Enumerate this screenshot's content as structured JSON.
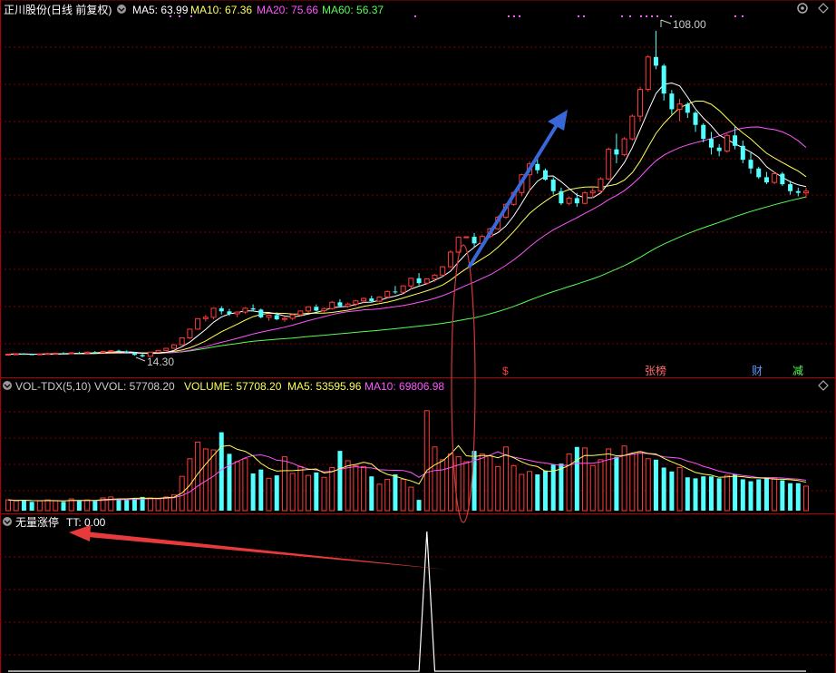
{
  "colors": {
    "background": "#000000",
    "up": "#ff3b3b",
    "down": "#54ffff",
    "ma5": "#ffffff",
    "ma10": "#ffff55",
    "ma20": "#ff55ff",
    "ma60": "#55ff55",
    "grid": "#800000",
    "arrow_blue": "#3a67d8",
    "arrow_red": "#e83a3a",
    "ellipse": "#d03a3a"
  },
  "main_panel": {
    "stock": "正川股份",
    "period": "(日线 前复权)",
    "ma5_label": "MA5: 63.99",
    "ma10_label": "MA10: 67.36",
    "ma20_label": "MA20: 75.66",
    "ma60_label": "MA60: 56.37",
    "high_label": "108.00",
    "low_label": "14.30",
    "markers": [
      "$",
      "张榜",
      "财",
      "减"
    ]
  },
  "volume_panel": {
    "name": "VOL-TDX(5,10)",
    "vvol": "VVOL: 57708.20",
    "volume": "VOLUME: 57708.20",
    "ma5": "MA5: 53595.96",
    "ma10": "MA10: 69806.98"
  },
  "signal_panel": {
    "name": "无量涨停",
    "tt": "TT: 0.00"
  },
  "chart_data": [
    {
      "type": "candlestick",
      "title": "正川股份(日线 前复权)",
      "series_labels": [
        "MA5",
        "MA10",
        "MA20",
        "MA60"
      ],
      "price_range": [
        14.3,
        108.0
      ],
      "grid": true,
      "candles_ohlc": [
        [
          15.1,
          15.4,
          14.9,
          15.2
        ],
        [
          15.2,
          15.5,
          15.0,
          15.3
        ],
        [
          15.3,
          15.5,
          15.1,
          15.2
        ],
        [
          15.2,
          15.4,
          15.0,
          15.1
        ],
        [
          15.1,
          15.4,
          14.9,
          15.3
        ],
        [
          15.3,
          15.6,
          15.1,
          15.4
        ],
        [
          15.4,
          15.7,
          15.2,
          15.5
        ],
        [
          15.5,
          15.8,
          15.3,
          15.4
        ],
        [
          15.4,
          15.8,
          15.2,
          15.6
        ],
        [
          15.6,
          15.9,
          15.3,
          15.5
        ],
        [
          15.5,
          16.0,
          15.3,
          15.8
        ],
        [
          15.8,
          16.1,
          15.5,
          15.7
        ],
        [
          15.7,
          16.2,
          15.6,
          16.0
        ],
        [
          16.0,
          16.4,
          15.8,
          16.2
        ],
        [
          16.2,
          16.5,
          15.8,
          16.0
        ],
        [
          16.0,
          16.3,
          15.5,
          15.6
        ],
        [
          15.6,
          15.8,
          14.8,
          15.0
        ],
        [
          15.0,
          15.3,
          14.3,
          14.6
        ],
        [
          14.6,
          15.9,
          14.5,
          15.8
        ],
        [
          15.8,
          16.4,
          15.6,
          16.3
        ],
        [
          16.3,
          17.0,
          16.1,
          16.9
        ],
        [
          16.9,
          18.0,
          16.7,
          17.9
        ],
        [
          17.9,
          20.0,
          17.8,
          19.9
        ],
        [
          19.9,
          22.5,
          19.6,
          22.4
        ],
        [
          22.4,
          25.5,
          22.2,
          25.4
        ],
        [
          25.4,
          26.5,
          24.6,
          25.8
        ],
        [
          25.8,
          28.5,
          25.2,
          28.4
        ],
        [
          28.4,
          29.0,
          26.6,
          27.5
        ],
        [
          27.5,
          28.2,
          26.2,
          26.8
        ],
        [
          26.8,
          27.5,
          25.8,
          27.3
        ],
        [
          27.3,
          28.6,
          26.8,
          28.4
        ],
        [
          28.4,
          29.5,
          27.6,
          28.0
        ],
        [
          28.0,
          28.3,
          25.5,
          25.8
        ],
        [
          25.8,
          26.6,
          24.8,
          26.4
        ],
        [
          26.4,
          27.2,
          25.0,
          25.2
        ],
        [
          25.2,
          26.2,
          24.5,
          25.5
        ],
        [
          25.5,
          26.8,
          25.0,
          26.5
        ],
        [
          26.5,
          27.8,
          26.0,
          27.6
        ],
        [
          27.6,
          29.0,
          27.0,
          28.8
        ],
        [
          28.8,
          29.5,
          27.5,
          27.7
        ],
        [
          27.7,
          28.6,
          27.2,
          28.3
        ],
        [
          28.3,
          30.5,
          28.0,
          30.1
        ],
        [
          30.1,
          31.0,
          28.6,
          29.0
        ],
        [
          29.0,
          30.0,
          28.5,
          29.6
        ],
        [
          29.6,
          30.8,
          29.0,
          30.5
        ],
        [
          30.5,
          31.5,
          29.8,
          31.2
        ],
        [
          31.2,
          32.0,
          30.0,
          30.4
        ],
        [
          30.4,
          31.8,
          30.1,
          31.6
        ],
        [
          31.6,
          33.5,
          31.2,
          33.2
        ],
        [
          33.2,
          34.8,
          32.5,
          33.0
        ],
        [
          33.0,
          35.0,
          32.8,
          34.8
        ],
        [
          34.8,
          37.2,
          33.8,
          37.0
        ],
        [
          37.0,
          38.5,
          35.0,
          35.6
        ],
        [
          35.6,
          37.0,
          35.2,
          36.8
        ],
        [
          36.8,
          38.2,
          36.0,
          37.9
        ],
        [
          37.9,
          40.5,
          37.5,
          40.3
        ],
        [
          40.3,
          45.0,
          40.0,
          44.5
        ],
        [
          44.5,
          49.0,
          44.2,
          48.8
        ],
        [
          48.8,
          49.0,
          48.5,
          48.9
        ],
        [
          48.9,
          50.0,
          46.0,
          47.0
        ],
        [
          47.0,
          49.5,
          46.5,
          49.0
        ],
        [
          49.0,
          51.5,
          48.5,
          51.2
        ],
        [
          51.2,
          55.0,
          50.8,
          54.5
        ],
        [
          54.5,
          58.5,
          54.0,
          58.2
        ],
        [
          58.2,
          62.0,
          57.8,
          61.6
        ],
        [
          61.6,
          67.0,
          60.5,
          66.7
        ],
        [
          66.7,
          70.5,
          62.0,
          69.8
        ],
        [
          69.8,
          72.5,
          67.0,
          68.0
        ],
        [
          68.0,
          68.5,
          65.0,
          65.3
        ],
        [
          65.3,
          66.0,
          61.0,
          62.0
        ],
        [
          62.0,
          63.0,
          58.0,
          58.5
        ],
        [
          58.5,
          60.5,
          58.0,
          60.0
        ],
        [
          60.0,
          61.5,
          57.5,
          58.5
        ],
        [
          58.5,
          62.0,
          58.2,
          61.5
        ],
        [
          61.5,
          63.5,
          60.0,
          62.0
        ],
        [
          62.0,
          66.0,
          61.5,
          65.5
        ],
        [
          65.5,
          74.5,
          65.2,
          74.0
        ],
        [
          74.0,
          78.5,
          70.0,
          72.5
        ],
        [
          72.5,
          77.5,
          72.0,
          77.0
        ],
        [
          77.0,
          84.0,
          76.5,
          83.5
        ],
        [
          83.5,
          92.0,
          82.0,
          91.2
        ],
        [
          91.2,
          101.0,
          90.5,
          100.5
        ],
        [
          100.5,
          108.0,
          97.0,
          98.0
        ],
        [
          98.0,
          98.5,
          88.0,
          90.0
        ],
        [
          90.0,
          91.0,
          84.0,
          85.5
        ],
        [
          85.5,
          88.5,
          82.0,
          87.0
        ],
        [
          87.0,
          87.5,
          83.0,
          84.5
        ],
        [
          84.5,
          85.0,
          79.0,
          81.0
        ],
        [
          81.0,
          81.5,
          76.0,
          77.0
        ],
        [
          77.0,
          79.0,
          72.5,
          74.5
        ],
        [
          74.5,
          75.5,
          72.0,
          73.5
        ],
        [
          73.5,
          78.5,
          73.0,
          78.0
        ],
        [
          78.0,
          80.5,
          74.0,
          75.0
        ],
        [
          75.0,
          76.5,
          70.0,
          71.0
        ],
        [
          71.0,
          73.0,
          67.0,
          68.5
        ],
        [
          68.5,
          69.0,
          65.5,
          66.0
        ],
        [
          66.0,
          67.5,
          64.0,
          64.5
        ],
        [
          64.5,
          67.5,
          64.0,
          67.0
        ],
        [
          67.0,
          67.5,
          63.5,
          64.0
        ],
        [
          64.0,
          65.0,
          61.0,
          62.0
        ],
        [
          62.0,
          63.0,
          60.5,
          61.5
        ],
        [
          61.5,
          63.0,
          60.0,
          62.0
        ]
      ]
    },
    {
      "type": "bar",
      "title": "VOL-TDX(5,10)",
      "series_labels": [
        "VOLUME",
        "MA5",
        "MA10"
      ],
      "volume_max_units": 10.0,
      "values": [
        1.1,
        1.0,
        1.1,
        0.9,
        1.0,
        1.1,
        1.0,
        0.9,
        1.2,
        1.0,
        1.1,
        1.0,
        1.3,
        1.4,
        1.2,
        1.1,
        1.3,
        1.4,
        1.3,
        1.2,
        1.4,
        1.6,
        3.5,
        5.3,
        7.0,
        6.3,
        6.2,
        8.0,
        5.8,
        5.0,
        5.3,
        3.8,
        4.2,
        3.3,
        3.6,
        5.5,
        3.8,
        4.5,
        3.6,
        3.9,
        3.4,
        4.4,
        6.1,
        5.1,
        4.6,
        4.5,
        3.5,
        2.7,
        3.2,
        3.7,
        3.2,
        2.4,
        1.1,
        10.2,
        6.5,
        5.2,
        5.8,
        5.5,
        5.0,
        6.1,
        5.8,
        5.6,
        4.5,
        6.5,
        4.6,
        3.7,
        4.0,
        3.7,
        4.1,
        4.7,
        4.8,
        5.8,
        6.5,
        6.4,
        4.6,
        5.2,
        6.3,
        5.5,
        6.6,
        5.8,
        6.0,
        5.3,
        5.2,
        4.4,
        4.0,
        4.4,
        3.4,
        3.3,
        3.5,
        3.5,
        3.3,
        3.6,
        3.7,
        3.2,
        3.0,
        3.2,
        3.4,
        3.3,
        3.1,
        2.8,
        2.8,
        2.5
      ]
    },
    {
      "type": "line",
      "title": "无量涨停",
      "series_labels": [
        "TT"
      ],
      "values": [
        0,
        0,
        0,
        0,
        0,
        0,
        0,
        0,
        0,
        0,
        0,
        0,
        0,
        0,
        0,
        0,
        0,
        0,
        0,
        0,
        0,
        0,
        0,
        0,
        0,
        0,
        0,
        0,
        0,
        0,
        0,
        0,
        0,
        0,
        0,
        0,
        0,
        0,
        0,
        0,
        0,
        0,
        0,
        0,
        0,
        0,
        0,
        0,
        0,
        0,
        0,
        0,
        0,
        1,
        0,
        0,
        0,
        0,
        0,
        0,
        0,
        0,
        0,
        0,
        0,
        0,
        0,
        0,
        0,
        0,
        0,
        0,
        0,
        0,
        0,
        0,
        0,
        0,
        0,
        0,
        0,
        0,
        0,
        0,
        0,
        0,
        0,
        0,
        0,
        0,
        0,
        0,
        0,
        0,
        0,
        0,
        0,
        0,
        0,
        0,
        0,
        0
      ]
    }
  ]
}
